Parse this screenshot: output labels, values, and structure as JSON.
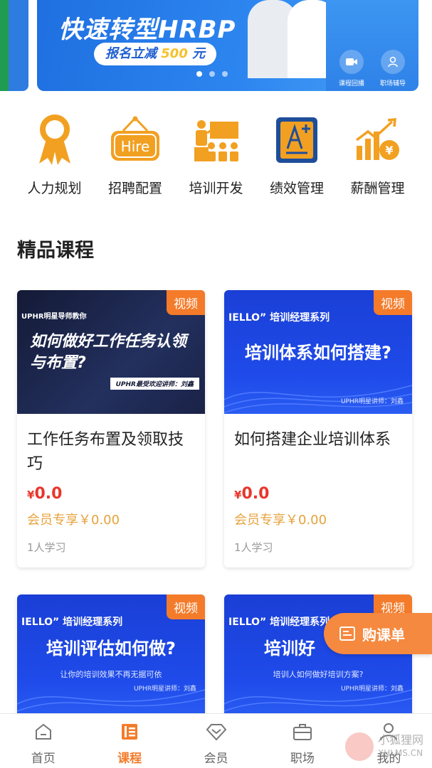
{
  "banner": {
    "title": "快速转型HRBP",
    "promo_prefix": "报名立减",
    "promo_amount": "500",
    "promo_suffix": "元",
    "side_buttons": [
      "课程回播",
      "职场辅导"
    ]
  },
  "categories": [
    {
      "label": "人力规划",
      "icon": "ribbon-icon"
    },
    {
      "label": "招聘配置",
      "icon": "hire-sign-icon"
    },
    {
      "label": "培训开发",
      "icon": "training-icon"
    },
    {
      "label": "绩效管理",
      "icon": "performance-doc-icon"
    },
    {
      "label": "薪酬管理",
      "icon": "salary-chart-icon"
    }
  ],
  "section_title": "精品课程",
  "courses": [
    {
      "tag": "视频",
      "thumb_kicker": "UPHR明星导师教你",
      "thumb_headline": "如何做好工作任务认领与布置?",
      "thumb_lecturer": "UPHR最受欢迎讲师：刘鑫",
      "title": "工作任务布置及领取技巧",
      "price_symbol": "¥",
      "price": "0.0",
      "member_price": "会员专享￥0.00",
      "learners": "1人学习"
    },
    {
      "tag": "视频",
      "thumb_kicker": "IELLO” 培训经理系列",
      "thumb_headline": "培训体系如何搭建?",
      "thumb_lecturer": "UPHR明星讲师：刘鑫",
      "title": "如何搭建企业培训体系",
      "price_symbol": "¥",
      "price": "0.0",
      "member_price": "会员专享￥0.00",
      "learners": "1人学习"
    },
    {
      "tag": "视频",
      "thumb_kicker": "IELLO” 培训经理系列",
      "thumb_headline": "培训评估如何做?",
      "thumb_sub": "让你的培训效果不再无据可依",
      "thumb_lecturer": "UPHR明星讲师：刘鑫"
    },
    {
      "tag": "视频",
      "thumb_kicker": "IELLO” 培训经理系列",
      "thumb_headline": "培训好",
      "thumb_sub": "培训人如何做好培训方案?",
      "thumb_lecturer": "UPHR明星讲师：刘鑫"
    }
  ],
  "cart_button": "购课单",
  "tabs": [
    {
      "label": "首页",
      "icon": "home-icon",
      "active": false
    },
    {
      "label": "课程",
      "icon": "course-icon",
      "active": true
    },
    {
      "label": "会员",
      "icon": "member-icon",
      "active": false
    },
    {
      "label": "职场",
      "icon": "workplace-icon",
      "active": false
    },
    {
      "label": "我的",
      "icon": "profile-icon",
      "active": false
    }
  ],
  "watermark": {
    "line1": "小狐狸网",
    "line2": "XHLMS.CN"
  },
  "colors": {
    "accent": "#f47b2a",
    "price": "#e8362b",
    "member": "#e6a23c",
    "banner": "#2d86f0"
  }
}
